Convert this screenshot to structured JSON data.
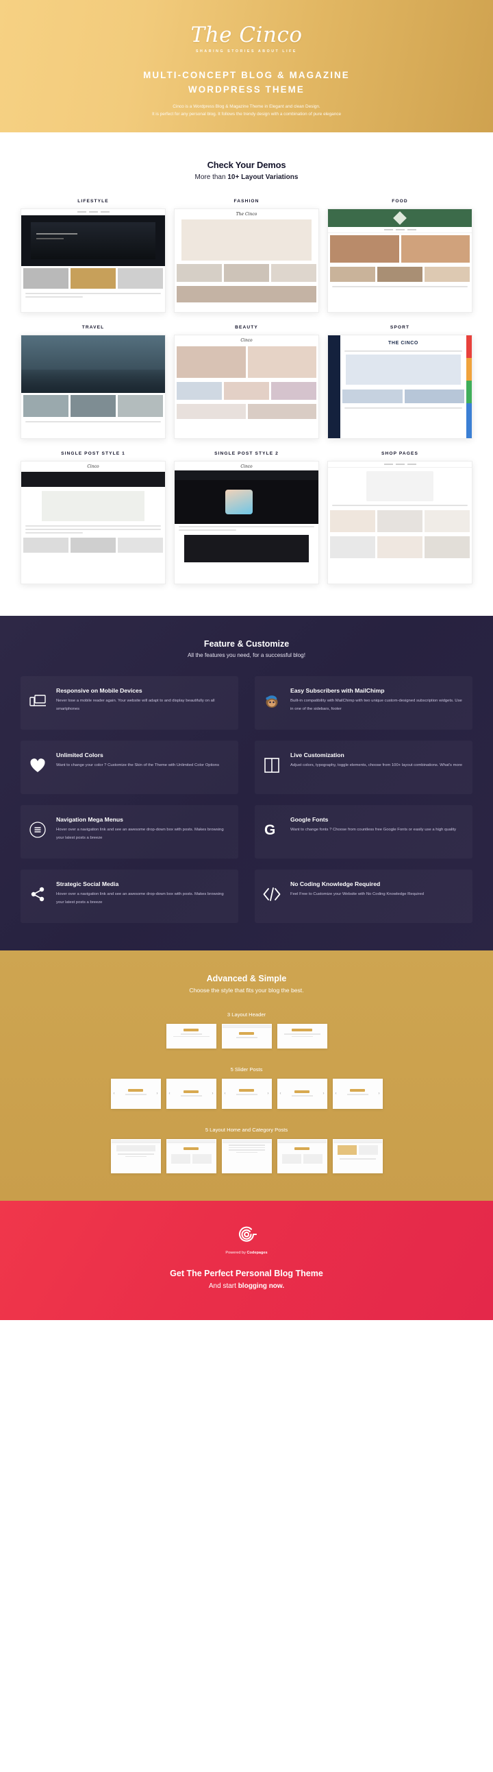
{
  "hero": {
    "logo_text": "The Cinco",
    "logo_tagline": "SHARING STORIES ABOUT LIFE",
    "headline_line1": "MULTI-CONCEPT BLOG & MAGAZINE",
    "headline_line2": "WORDPRESS THEME",
    "paragraph_line1": "Cinco is a Wordpress Blog & Magazine Theme in Elegant and clean Design.",
    "paragraph_line2": "It is perfect for any personal blog. It follows the trendy design with a combination of pure elegance",
    "bg_start": "#f6d183",
    "bg_end": "#cfa24f"
  },
  "demos": {
    "title": "Check Your Demos",
    "subtitle_prefix": "More than ",
    "subtitle_strong": "10+ Layout Variations",
    "items": [
      {
        "label": "LIFESTYLE"
      },
      {
        "label": "FASHION"
      },
      {
        "label": "FOOD"
      },
      {
        "label": "TRAVEL"
      },
      {
        "label": "BEAUTY"
      },
      {
        "label": "SPORT"
      },
      {
        "label": "SINGLE POST STYLE 1"
      },
      {
        "label": "SINGLE POST STYLE 2"
      },
      {
        "label": "SHOP PAGES"
      }
    ]
  },
  "features": {
    "title": "Feature & Customize",
    "subtitle": "All the features you need, for a successful blog!",
    "bg": "#2b2642",
    "items": [
      {
        "icon": "devices-icon",
        "title": "Responsive on Mobile Devices",
        "desc": "Never lose a mobile reader again. Your website will adapt to and display beautifully on all smartphones"
      },
      {
        "icon": "mailchimp-monkey-icon",
        "title": "Easy Subscribers with MailChimp",
        "desc": "Built-in compatibility with MailChimp with two unique custom-designed subscription widgets. Use in one of the sidebars, footer"
      },
      {
        "icon": "heart-icon",
        "title": "Unlimited Colors",
        "desc": "Want to change your color ? Customize the Skin of the Theme with Unlimited Color Options"
      },
      {
        "icon": "columns-layout-icon",
        "title": "Live Customization",
        "desc": "Adjust colors, typography, toggle elements, choose from 100+ layout combinations. What's more"
      },
      {
        "icon": "hamburger-menu-icon",
        "title": "Navigation Mega Menus",
        "desc": "Hover over a navigation link and see an awesome drop-down box with posts. Makes browsing your latest posts a breeze"
      },
      {
        "icon": "google-g-icon",
        "title": "Google Fonts",
        "desc": "Want to change fonts ? Choose from countless free Google Fonts or easily use a high quality"
      },
      {
        "icon": "share-nodes-icon",
        "title": "Strategic Social Media",
        "desc": "Hover over a navigation link and see an awesome drop-down box with posts. Makes browsing your latest posts a breeze"
      },
      {
        "icon": "code-brackets-icon",
        "title": "No Coding Knowledge Required",
        "desc": "Feel Free to Customize your Website with No Coding Knowledge Required"
      }
    ]
  },
  "advanced": {
    "title": "Advanced & Simple",
    "subtitle": "Choose the style that fits your blog the best.",
    "bg": "#cba24f",
    "groups": [
      {
        "label": "3 Layout Header",
        "count": 3,
        "kind": "header"
      },
      {
        "label": "5 Slider Posts",
        "count": 5,
        "kind": "slider"
      },
      {
        "label": "5 Layout Home and Category Posts",
        "count": 5,
        "kind": "home"
      }
    ]
  },
  "footer": {
    "logo_icon": "codepages-spiral-logo",
    "powered_prefix": "Powered by ",
    "powered_brand": "Codepages",
    "headline": "Get The Perfect Personal Blog Theme",
    "sub_prefix": "And start ",
    "sub_strong": "blogging now.",
    "bg_start": "#f0374b",
    "bg_end": "#e4284a"
  }
}
